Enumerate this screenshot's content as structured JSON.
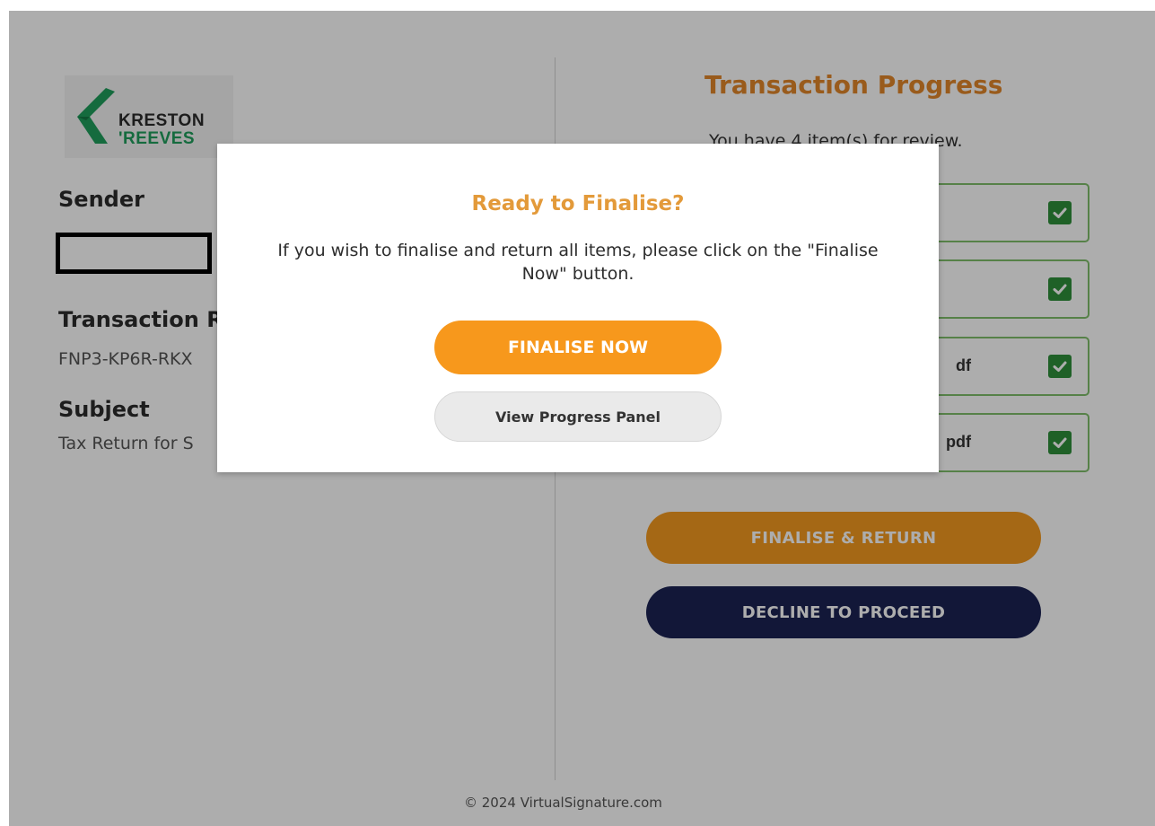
{
  "brand": {
    "logo_line1": "KRESTON",
    "logo_line2": "'REEVES"
  },
  "left_panel": {
    "sender_label": "Sender",
    "transaction_ref_label": "Transaction R",
    "transaction_ref_value": "FNP3-KP6R-RKX",
    "subject_label": "Subject",
    "subject_value": "Tax Return for S"
  },
  "right_panel": {
    "title": "Transaction Progress",
    "subtitle": "You have 4 item(s) for review.",
    "items": [
      {
        "name": ""
      },
      {
        "name": ""
      },
      {
        "name": "df"
      },
      {
        "name": "pdf"
      }
    ],
    "finalise_return_label": "FINALISE & RETURN",
    "decline_label": "DECLINE TO PROCEED"
  },
  "modal": {
    "title": "Ready to Finalise?",
    "text": "If you wish to finalise and return all items, please click on the \"Finalise Now\" button.",
    "finalise_now_label": "FINALISE NOW",
    "view_progress_label": "View Progress Panel"
  },
  "footer": {
    "copyright": "© 2024 VirtualSignature.com"
  },
  "colors": {
    "accent_orange": "#f7981c",
    "title_orange": "#e2872a",
    "navy": "#1b2353",
    "check_green": "#2f8f3a",
    "brand_green": "#1f9e5c"
  }
}
